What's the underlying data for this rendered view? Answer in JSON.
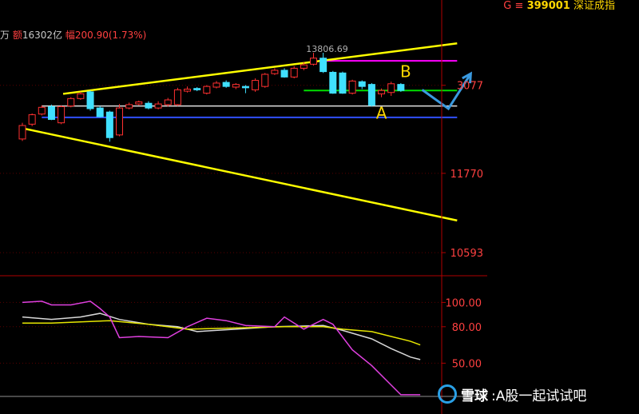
{
  "header": {
    "left_unit": "万",
    "left_amount_label": "额",
    "left_amount_value": "16302亿",
    "left_change_label": "幅",
    "left_change_value": "200.90(1.73%)",
    "right_g": "G",
    "right_menu": "≡",
    "right_code": "399001",
    "right_name": "深证成指"
  },
  "watermark": {
    "brand": "雪球",
    "text": ":A股一起试试吧"
  },
  "chart_data": {
    "type": "candlestick",
    "colors": {
      "up": "#ff3030",
      "down": "#40e0ff",
      "trend_line": "#ffff00",
      "resistance_line": "#ff00ff",
      "level_green": "#00dd00",
      "level_white": "#e0e0e0",
      "level_blue": "#3050ff",
      "forecast_arrow": "#3a9ae0",
      "axis": "#b00000",
      "tick_text": "#ff4040",
      "annotation": "#ffd700",
      "osc_white": "#d8d8d8",
      "osc_yellow": "#e6e600",
      "osc_magenta": "#e040e0"
    },
    "price_axis": {
      "range": [
        10250,
        13750
      ],
      "ticks": [
        {
          "value": 13077,
          "label": "3077"
        },
        {
          "value": 11770,
          "label": "11770"
        },
        {
          "value": 10593,
          "label": "10593"
        }
      ]
    },
    "candles": [
      {
        "o": 12280,
        "c": 12480,
        "h": 12520,
        "l": 12250
      },
      {
        "o": 12500,
        "c": 12640,
        "h": 12660,
        "l": 12470
      },
      {
        "o": 12650,
        "c": 12750,
        "h": 12780,
        "l": 12630
      },
      {
        "o": 12760,
        "c": 12570,
        "h": 12790,
        "l": 12560
      },
      {
        "o": 12520,
        "c": 12760,
        "h": 12780,
        "l": 12500
      },
      {
        "o": 12770,
        "c": 12880,
        "h": 12900,
        "l": 12750
      },
      {
        "o": 12880,
        "c": 12950,
        "h": 12980,
        "l": 12860
      },
      {
        "o": 12980,
        "c": 12730,
        "h": 13000,
        "l": 12700
      },
      {
        "o": 12740,
        "c": 12610,
        "h": 12770,
        "l": 12600
      },
      {
        "o": 12680,
        "c": 12300,
        "h": 12700,
        "l": 12240
      },
      {
        "o": 12340,
        "c": 12740,
        "h": 12800,
        "l": 12320
      },
      {
        "o": 12740,
        "c": 12790,
        "h": 12820,
        "l": 12720
      },
      {
        "o": 12800,
        "c": 12830,
        "h": 12850,
        "l": 12780
      },
      {
        "o": 12810,
        "c": 12740,
        "h": 12840,
        "l": 12720
      },
      {
        "o": 12740,
        "c": 12800,
        "h": 12840,
        "l": 12720
      },
      {
        "o": 12790,
        "c": 12860,
        "h": 12890,
        "l": 12760
      },
      {
        "o": 12790,
        "c": 13010,
        "h": 13040,
        "l": 12770
      },
      {
        "o": 12990,
        "c": 13020,
        "h": 13060,
        "l": 12970
      },
      {
        "o": 13030,
        "c": 13010,
        "h": 13050,
        "l": 12990
      },
      {
        "o": 12960,
        "c": 13060,
        "h": 13080,
        "l": 12940
      },
      {
        "o": 13050,
        "c": 13110,
        "h": 13140,
        "l": 13030
      },
      {
        "o": 13120,
        "c": 13060,
        "h": 13150,
        "l": 13040
      },
      {
        "o": 13050,
        "c": 13090,
        "h": 13110,
        "l": 13020
      },
      {
        "o": 13060,
        "c": 13040,
        "h": 13080,
        "l": 12960
      },
      {
        "o": 13010,
        "c": 13150,
        "h": 13180,
        "l": 12980
      },
      {
        "o": 13060,
        "c": 13240,
        "h": 13260,
        "l": 13040
      },
      {
        "o": 13250,
        "c": 13300,
        "h": 13330,
        "l": 13230
      },
      {
        "o": 13300,
        "c": 13200,
        "h": 13330,
        "l": 13190
      },
      {
        "o": 13200,
        "c": 13330,
        "h": 13360,
        "l": 13180
      },
      {
        "o": 13330,
        "c": 13380,
        "h": 13420,
        "l": 13300
      },
      {
        "o": 13390,
        "c": 13480,
        "h": 13560,
        "l": 13370
      },
      {
        "o": 13480,
        "c": 13280,
        "h": 13560,
        "l": 13260
      },
      {
        "o": 13270,
        "c": 12960,
        "h": 13290,
        "l": 12950
      },
      {
        "o": 13260,
        "c": 12960,
        "h": 13280,
        "l": 12950
      },
      {
        "o": 12960,
        "c": 13140,
        "h": 13160,
        "l": 12940
      },
      {
        "o": 13130,
        "c": 13060,
        "h": 13150,
        "l": 13020
      },
      {
        "o": 13090,
        "c": 12780,
        "h": 13110,
        "l": 12760
      },
      {
        "o": 12950,
        "c": 13000,
        "h": 13030,
        "l": 12900
      },
      {
        "o": 12970,
        "c": 13100,
        "h": 13130,
        "l": 12920
      },
      {
        "o": 13090,
        "c": 13000,
        "h": 13110,
        "l": 12980
      }
    ],
    "lines": {
      "wedge_upper": [
        {
          "i": 4.2,
          "v": 12950
        },
        {
          "i": 44.8,
          "v": 13700
        }
      ],
      "wedge_lower": [
        {
          "i": 0,
          "v": 12440
        },
        {
          "i": 44.8,
          "v": 11070
        }
      ],
      "resistance": {
        "from": 31,
        "to": 44.8,
        "v": 13440
      },
      "level_green": {
        "from": 29,
        "to": 44.8,
        "v": 13000
      },
      "level_white": {
        "from": 2,
        "to": 44.8,
        "v": 12770
      },
      "level_blue": {
        "from": 2,
        "to": 44.8,
        "v": 12600
      }
    },
    "forecast_path": [
      {
        "i": 41.2,
        "v": 13010
      },
      {
        "i": 43.9,
        "v": 12730
      },
      {
        "i": 46.2,
        "v": 13250
      }
    ],
    "annotations": [
      {
        "text": "B",
        "i": 39.5,
        "v": 13200
      },
      {
        "text": "A",
        "i": 37,
        "v": 12580
      },
      {
        "text": "13806.69",
        "i": 31.4,
        "v": 13570
      }
    ],
    "oscillator": {
      "range": [
        20,
        120
      ],
      "ticks": [
        100,
        80,
        50
      ],
      "tick_labels": [
        "100.00",
        "80.00",
        "50.00"
      ],
      "series": [
        {
          "color_key": "osc_white",
          "values": [
            [
              0,
              88
            ],
            [
              3,
              86
            ],
            [
              6,
              88
            ],
            [
              8,
              91
            ],
            [
              10,
              86
            ],
            [
              13,
              82
            ],
            [
              16,
              80
            ],
            [
              18,
              76
            ],
            [
              22,
              78
            ],
            [
              26,
              80
            ],
            [
              31,
              81
            ],
            [
              33,
              77
            ],
            [
              36,
              70
            ],
            [
              38,
              62
            ],
            [
              40,
              55
            ],
            [
              41,
              53
            ]
          ]
        },
        {
          "color_key": "osc_yellow",
          "values": [
            [
              0,
              83
            ],
            [
              3,
              83
            ],
            [
              6,
              84
            ],
            [
              9,
              85
            ],
            [
              13,
              82
            ],
            [
              17,
              78
            ],
            [
              22,
              79
            ],
            [
              27,
              80
            ],
            [
              31,
              80
            ],
            [
              33,
              78
            ],
            [
              36,
              76
            ],
            [
              38,
              72
            ],
            [
              40,
              68
            ],
            [
              41,
              65
            ]
          ]
        },
        {
          "color_key": "osc_magenta",
          "values": [
            [
              0,
              100
            ],
            [
              2,
              101
            ],
            [
              3,
              98
            ],
            [
              5,
              98
            ],
            [
              7,
              101
            ],
            [
              8,
              95
            ],
            [
              9,
              88
            ],
            [
              10,
              71
            ],
            [
              12,
              72
            ],
            [
              15,
              71
            ],
            [
              17,
              80
            ],
            [
              19,
              87
            ],
            [
              21,
              85
            ],
            [
              23,
              81
            ],
            [
              26,
              80
            ],
            [
              27,
              88
            ],
            [
              29,
              78
            ],
            [
              31,
              86
            ],
            [
              32,
              82
            ],
            [
              34,
              61
            ],
            [
              36,
              48
            ],
            [
              38,
              32
            ],
            [
              39,
              24
            ],
            [
              41,
              24
            ]
          ]
        }
      ]
    }
  }
}
